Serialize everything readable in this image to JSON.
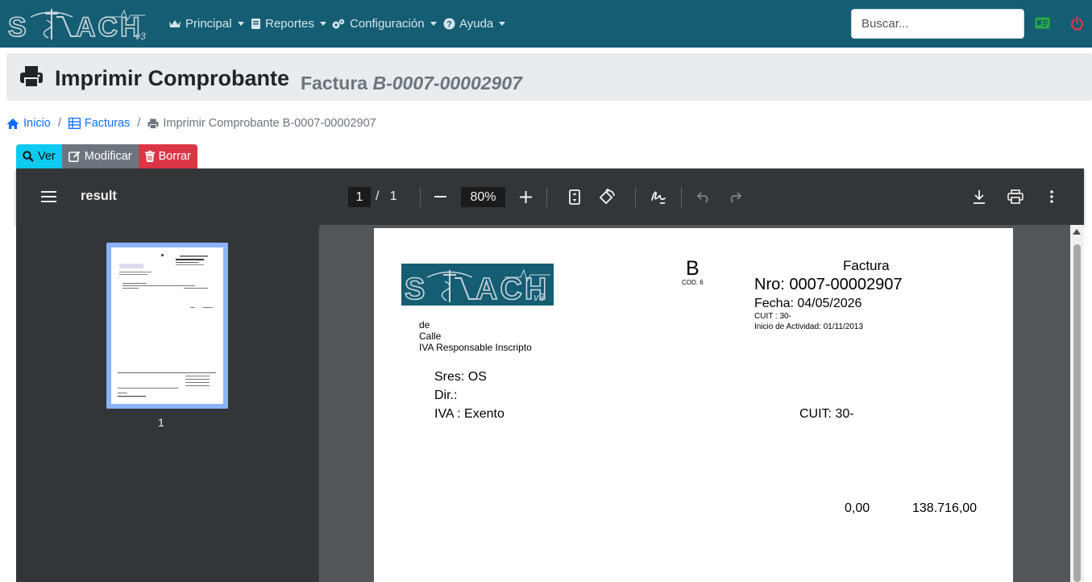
{
  "navbar": {
    "brand": "STACH",
    "brand_version": "v3",
    "menu": [
      {
        "label": "Principal",
        "icon": "users-icon"
      },
      {
        "label": "Reportes",
        "icon": "book-icon"
      },
      {
        "label": "Configuración",
        "icon": "cogs-icon"
      },
      {
        "label": "Ayuda",
        "icon": "question-circle-icon"
      }
    ],
    "search_placeholder": "Buscar...",
    "accent_color": "#145d73"
  },
  "header": {
    "title": "Imprimir Comprobante",
    "subtitle_prefix": "Factura",
    "subtitle_number": "B-0007-00002907"
  },
  "breadcrumb": {
    "home": "Inicio",
    "section": "Facturas",
    "current": "Imprimir Comprobante B-0007-00002907"
  },
  "actions": {
    "view": "Ver",
    "edit": "Modificar",
    "delete": "Borrar"
  },
  "pdf_viewer": {
    "title": "result",
    "current_page": "1",
    "page_separator": "/",
    "total_pages": "1",
    "zoom": "80%",
    "thumbnail_label": "1"
  },
  "invoice": {
    "letter": "B",
    "cod": "COD. 6",
    "type": "Factura",
    "number": "Nro: 0007-00002907",
    "date": "Fecha: 04/05/2026",
    "cuit": "CUIT : 30-",
    "activity_start": "Inicio de Actividad: 01/11/2013",
    "company_line1": "de",
    "company_line2": "Calle",
    "company_line3": "IVA Responsable Inscripto",
    "client_name": "Sres: OS",
    "client_address": "Dir.:",
    "client_iva": "IVA : Exento",
    "client_cuit": "CUIT: 30-",
    "amount_1": "0,00",
    "amount_2": "138.716,00"
  }
}
